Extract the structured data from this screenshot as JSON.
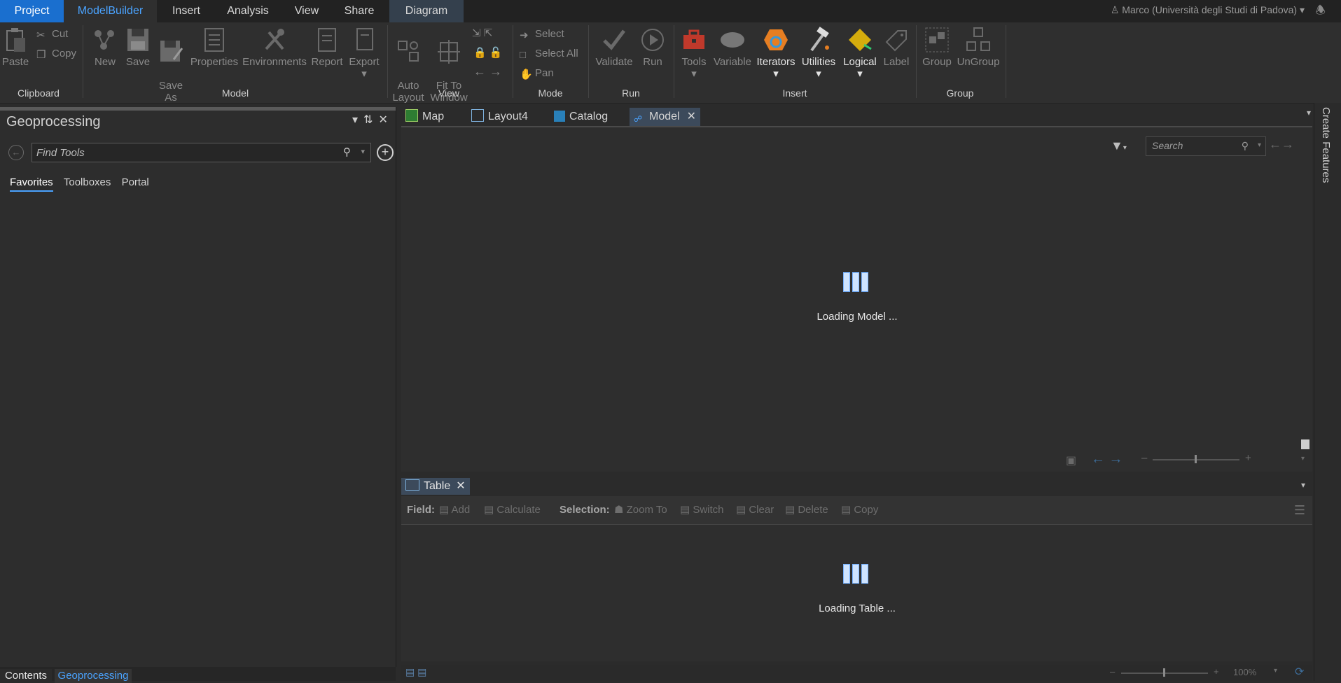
{
  "menubar": {
    "tabs": [
      "Project",
      "ModelBuilder",
      "Insert",
      "Analysis",
      "View",
      "Share",
      "Diagram"
    ],
    "user": "Marco (Università degli Studi di Padova)"
  },
  "ribbon": {
    "clipboard": {
      "paste": "Paste",
      "cut": "Cut",
      "copy": "Copy",
      "label": "Clipboard"
    },
    "model": {
      "new": "New",
      "save": "Save",
      "save_as": "Save\nAs",
      "properties": "Properties",
      "environments": "Environments",
      "report": "Report",
      "export": "Export",
      "label": "Model"
    },
    "view": {
      "auto_layout": "Auto\nLayout",
      "fit_to_window": "Fit To\nWindow",
      "label": "View"
    },
    "mode": {
      "select": "Select",
      "select_all": "Select All",
      "pan": "Pan",
      "label": "Mode"
    },
    "run": {
      "validate": "Validate",
      "run": "Run",
      "label": "Run"
    },
    "insert": {
      "tools": "Tools",
      "variable": "Variable",
      "iterators": "Iterators",
      "utilities": "Utilities",
      "logical": "Logical",
      "label_btn": "Label",
      "label": "Insert"
    },
    "group": {
      "group": "Group",
      "ungroup": "UnGroup",
      "label": "Group"
    }
  },
  "geoprocessing": {
    "title": "Geoprocessing",
    "find_placeholder": "Find Tools",
    "tabs": [
      "Favorites",
      "Toolboxes",
      "Portal"
    ]
  },
  "bottom_tabs": [
    "Contents",
    "Geoprocessing"
  ],
  "doc_tabs": [
    "Map",
    "Layout4",
    "Catalog",
    "Model"
  ],
  "model": {
    "loading": "Loading Model ...",
    "search_placeholder": "Search"
  },
  "table": {
    "tab": "Table",
    "field_label": "Field:",
    "add": "Add",
    "calculate": "Calculate",
    "selection_label": "Selection:",
    "zoom_to": "Zoom To",
    "switch": "Switch",
    "clear": "Clear",
    "delete": "Delete",
    "copy": "Copy",
    "loading": "Loading Table ...",
    "zoom": "100%"
  },
  "right_panel": "Create Features",
  "colors": {
    "accent": "#4aa3ff",
    "project_tab": "#1a6fcf"
  }
}
